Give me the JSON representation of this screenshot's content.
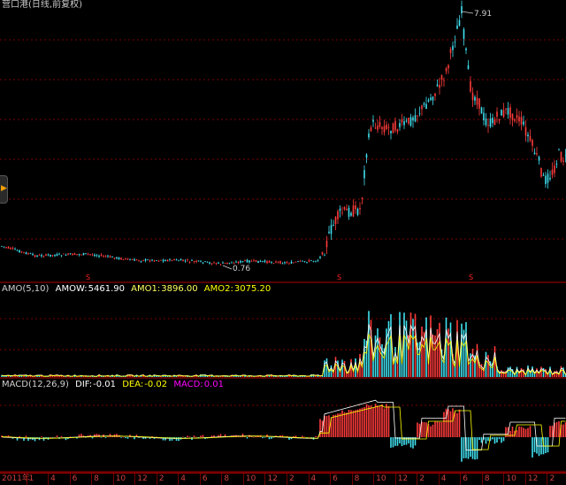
{
  "title": "营口港(日线,前复权)",
  "side_handle_icon": "arrow-right-icon",
  "price": {
    "high_label": "7.91",
    "low_label": "0.76",
    "s_marks": [
      "S",
      "S",
      "S"
    ]
  },
  "amo": {
    "name": "AMO(5,10)",
    "amow_label": "AMOW:",
    "amow_value": "5461.90",
    "amo1_label": "AMO1:",
    "amo1_value": "3896.00",
    "amo2_label": "AMO2:",
    "amo2_value": "3075.20"
  },
  "macd": {
    "name": "MACD(12,26,9)",
    "dif_label": "DIF:",
    "dif_value": "-0.01",
    "dea_label": "DEA:",
    "dea_value": "-0.02",
    "macd_label": "MACD:",
    "macd_value": "0.01"
  },
  "time_axis": {
    "labels": [
      "2011年",
      "1",
      "4",
      "6",
      "8",
      "10",
      "12",
      "2",
      "4",
      "6",
      "8",
      "10",
      "12",
      "2",
      "4",
      "6",
      "8",
      "10",
      "12",
      "2",
      "4",
      "6",
      "8",
      "10",
      "12",
      "2"
    ]
  },
  "colors": {
    "up": "#ff3b3b",
    "down": "#40e0f0",
    "grid": "#7a0000",
    "amow": "#ffffff",
    "amo1": "#ffff00",
    "amo2": "#ff00ff",
    "dif": "#ffffff",
    "dea": "#ffff00",
    "macd": "#ff00ff"
  }
}
